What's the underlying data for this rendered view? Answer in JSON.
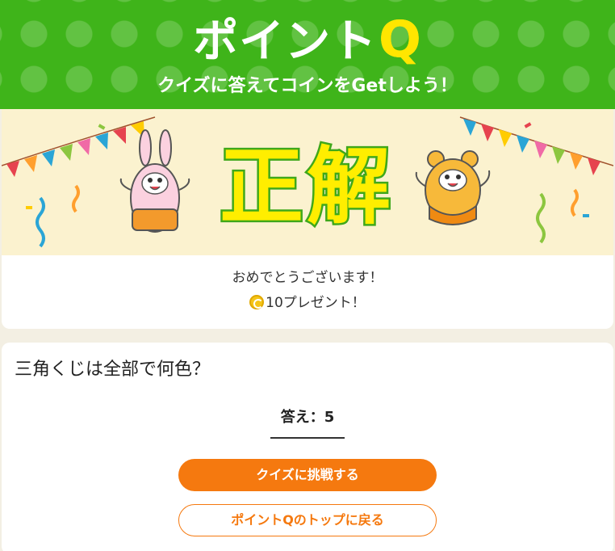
{
  "header": {
    "logo_text": "ポイント",
    "logo_q": "Q",
    "tagline": "クイズに答えてコインをGetしよう！"
  },
  "result": {
    "banner_text": "正解",
    "congrats": "おめでとうございます！",
    "reward": "10プレゼント！",
    "reward_icon": "coin-icon"
  },
  "quiz": {
    "question": "三角くじは全部で何色？",
    "answer": "答え：5"
  },
  "buttons": {
    "challenge": "クイズに挑戦する",
    "back_top": "ポイントQのトップに戻る"
  },
  "colors": {
    "header_green": "#3fb41a",
    "accent_orange": "#f5790f",
    "banner_yellow": "#ffee00"
  }
}
